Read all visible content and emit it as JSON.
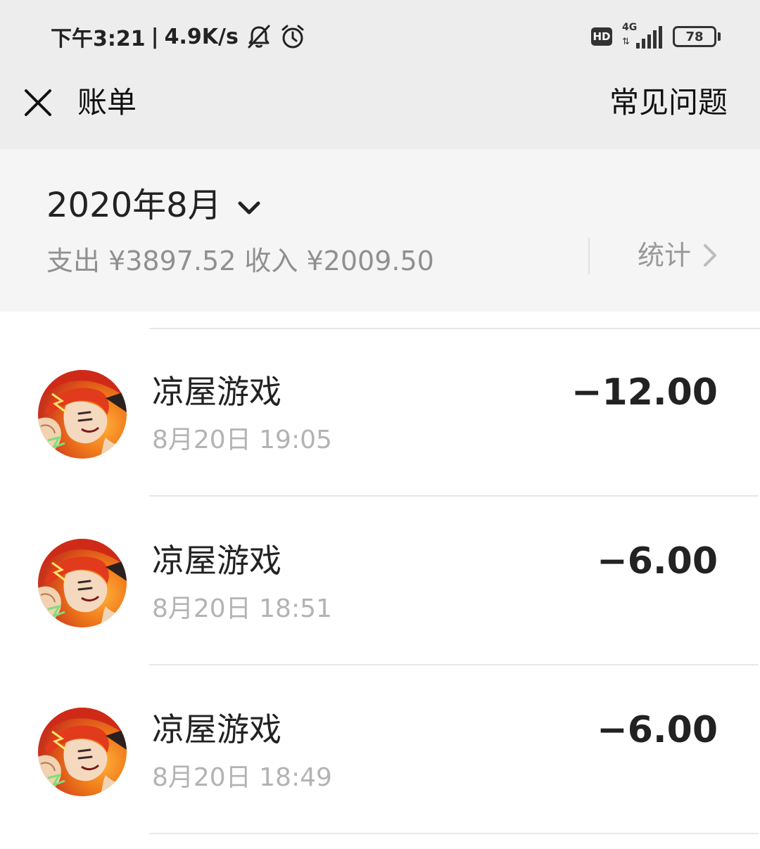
{
  "status_bar": {
    "time": "下午3:21",
    "separator": "|",
    "net_speed": "4.9K/s",
    "mute_icon": "bell-off-icon",
    "alarm_icon": "alarm-clock-icon",
    "hd_label": "HD",
    "network": "4G",
    "battery": "78"
  },
  "nav": {
    "close_icon": "close-icon",
    "title": "账单",
    "faq_label": "常见问题"
  },
  "summary": {
    "month": "2020年8月",
    "expense": "支出 ¥3897.52",
    "income": "收入 ¥2009.50",
    "stats_label": "统计"
  },
  "transactions": [
    {
      "name": "凉屋游戏",
      "time": "8月20日 19:05",
      "amount": "−12.00"
    },
    {
      "name": "凉屋游戏",
      "time": "8月20日 18:51",
      "amount": "−6.00"
    },
    {
      "name": "凉屋游戏",
      "time": "8月20日 18:49",
      "amount": "−6.00"
    }
  ],
  "colors": {
    "header_bg": "#ededed",
    "summary_bg": "#f5f5f5",
    "secondary_text": "#909090",
    "avatar_red": "#d8361e",
    "avatar_orange": "#f07a1a"
  }
}
